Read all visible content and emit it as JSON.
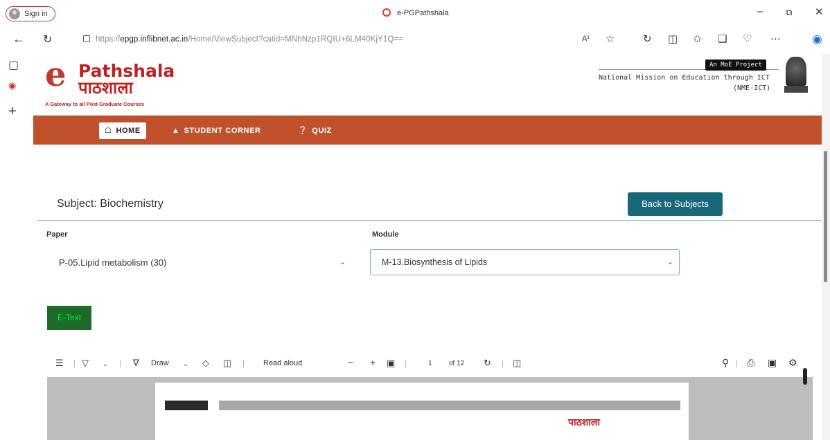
{
  "browser": {
    "sign_in": "Sign in",
    "tab_title": "e-PGPathshala",
    "url_host": "epgp.inflibnet.ac.in",
    "url_prefix": "https://",
    "url_path": "/Home/ViewSubject?catid=MNhNzp1RQIU+6LM40KjY1Q==",
    "read_aloud_icon_text": "A¹"
  },
  "header": {
    "logo_e": "e",
    "logo_line1": "Pathshala",
    "logo_line2": "पाठशाला",
    "tagline": "A Gateway to all Post Graduate Courses",
    "moe_badge": "An MoE Project",
    "mission_line1": "National Mission on Education through ICT",
    "mission_line2": "(NME-ICT)"
  },
  "nav": {
    "home": "HOME",
    "student_corner": "STUDENT CORNER",
    "quiz": "QUIZ"
  },
  "subject": {
    "title": "Subject: Biochemistry",
    "back_button": "Back to Subjects"
  },
  "paper": {
    "label": "Paper",
    "value": "P-05.Lipid metabolism (30)"
  },
  "module": {
    "label": "Module",
    "value": "M-13.Biosynthesis of Lipids"
  },
  "etext_button": "E-Text",
  "pdf_toolbar": {
    "draw": "Draw",
    "read_aloud": "Read aloud",
    "page_current": "1",
    "page_total": "of 12"
  },
  "pdf_page": {
    "mini_logo": "पाठशाला"
  }
}
